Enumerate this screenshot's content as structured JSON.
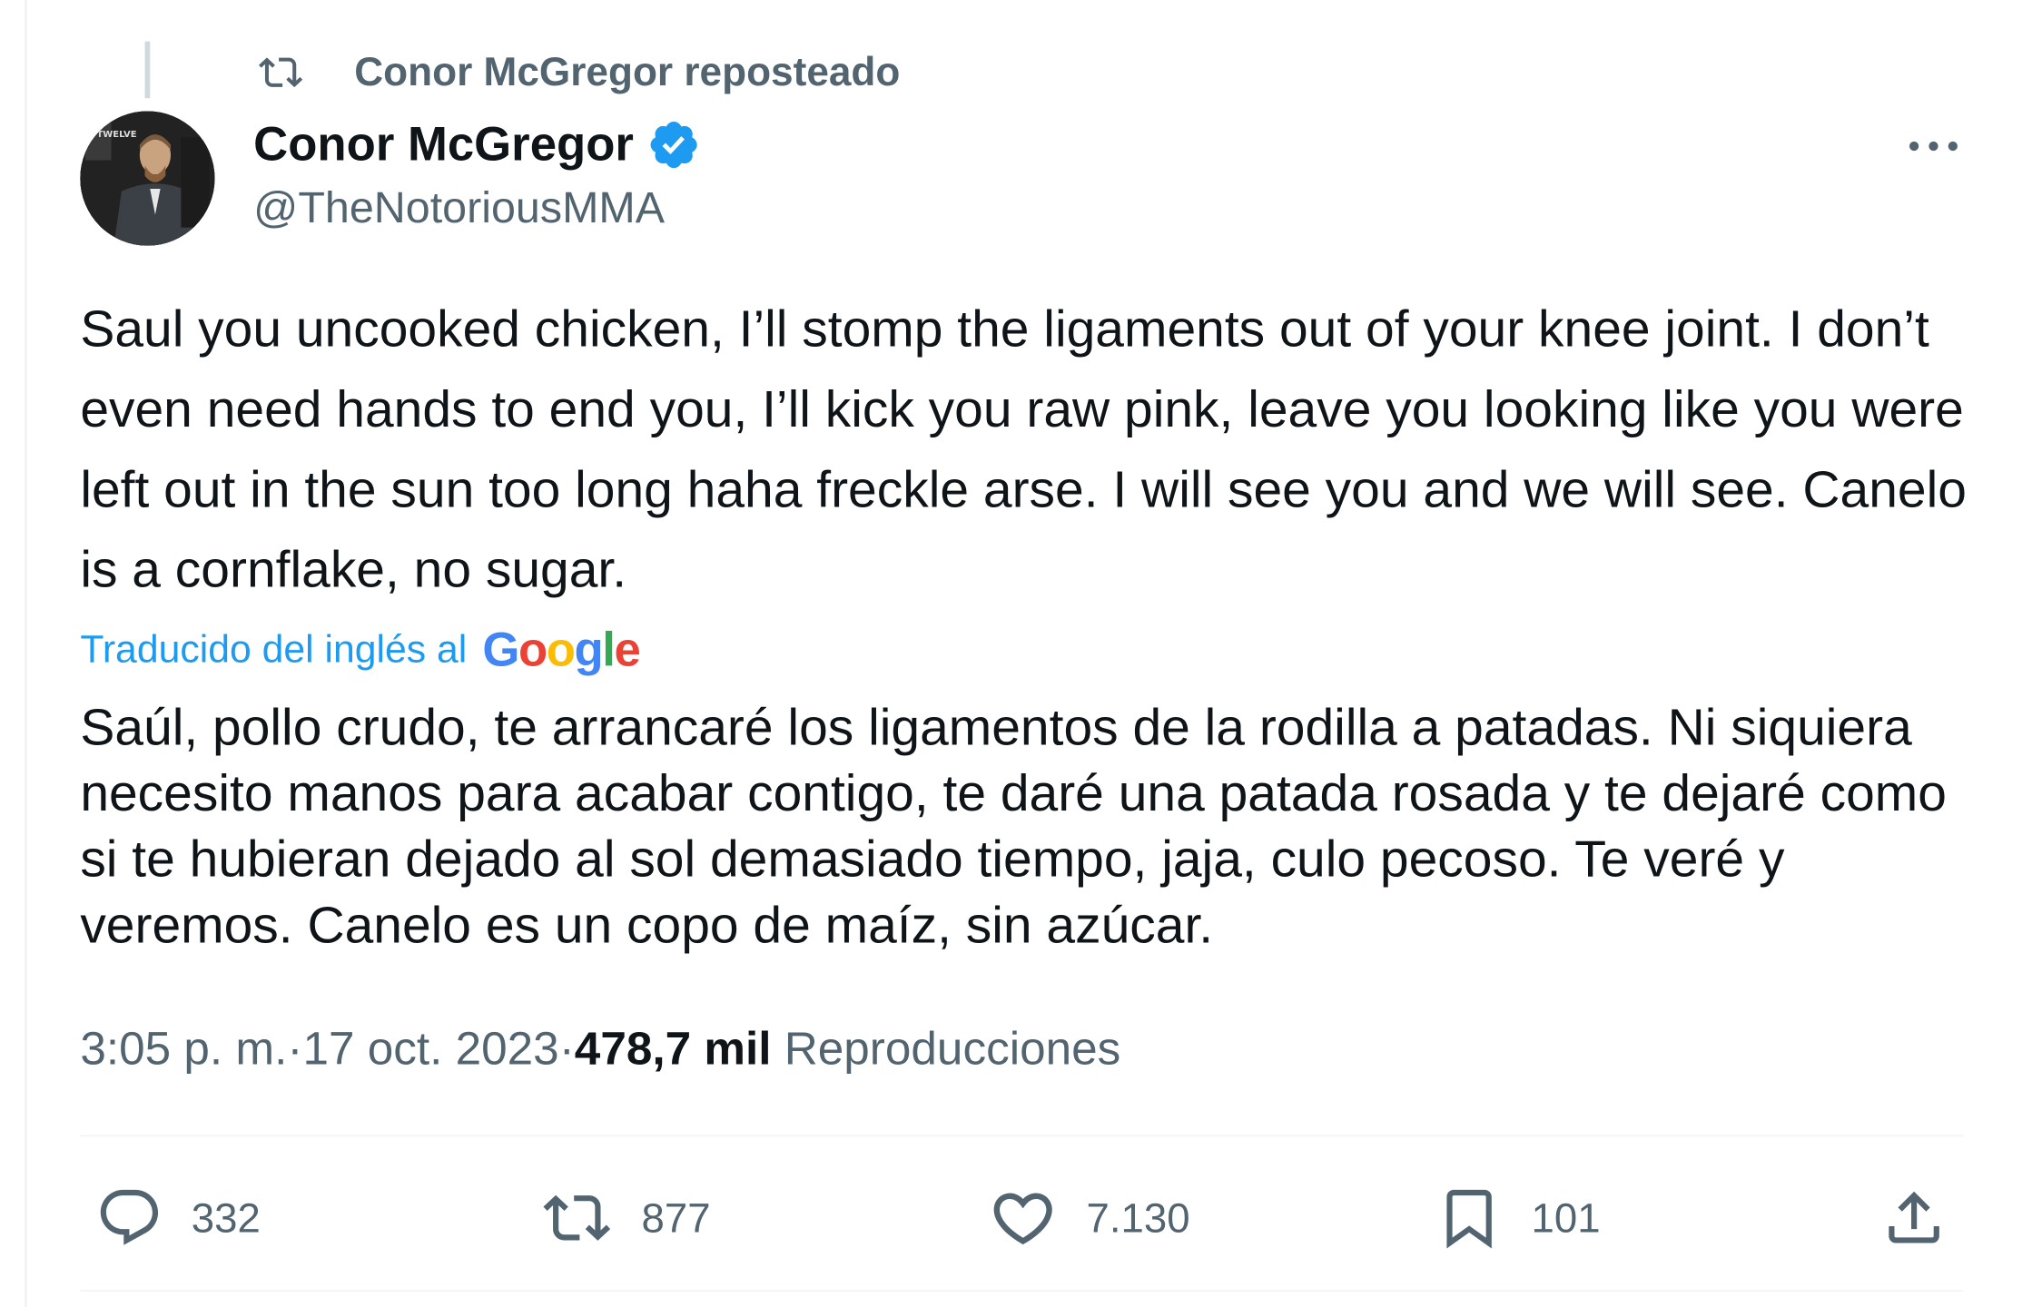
{
  "repost": {
    "icon": "repost-icon",
    "label": "Conor McGregor reposteado"
  },
  "author": {
    "avatar_icon": "avatar",
    "name": "Conor McGregor",
    "verified_icon": "verified-badge-icon",
    "handle": "@TheNotoriousMMA",
    "avatar_sign_text": "SUPER TWELVE"
  },
  "more_icon": "more-icon",
  "tweet": {
    "text": "Saul you uncooked chicken, I’ll stomp the ligaments out of your knee joint. I don’t even need hands to end you, I’ll kick you raw pink, leave you looking like you were left out in the sun too long haha freckle arse. I will see you and we will see. Canelo is a cornflake, no sugar.",
    "translation_label": "Traducido del inglés al",
    "translation_provider": "Google",
    "translated_text": "Saúl, pollo crudo, te arrancaré los ligamentos de la rodilla a patadas. Ni siquiera necesito manos para acabar contigo, te daré una patada rosada y te dejaré como si te hubieran dejado al sol demasiado tiempo, jaja, culo pecoso. Te veré y veremos. Canelo es un copo de maíz, sin azúcar."
  },
  "meta": {
    "time": "3:05 p. m.",
    "separator": " · ",
    "date": "17 oct. 2023",
    "views_count": "478,7 mil",
    "views_label": "Reproducciones"
  },
  "actions": {
    "reply": {
      "icon": "reply-icon",
      "count": "332"
    },
    "repost": {
      "icon": "repost-icon",
      "count": "877"
    },
    "like": {
      "icon": "heart-icon",
      "count": "7.130"
    },
    "bookmark": {
      "icon": "bookmark-icon",
      "count": "101"
    },
    "share": {
      "icon": "share-icon"
    }
  },
  "colors": {
    "text": "#0f1419",
    "secondary": "#536471",
    "link": "#1d9bf0",
    "verified": "#1d9bf0",
    "border": "#eff3f4"
  }
}
